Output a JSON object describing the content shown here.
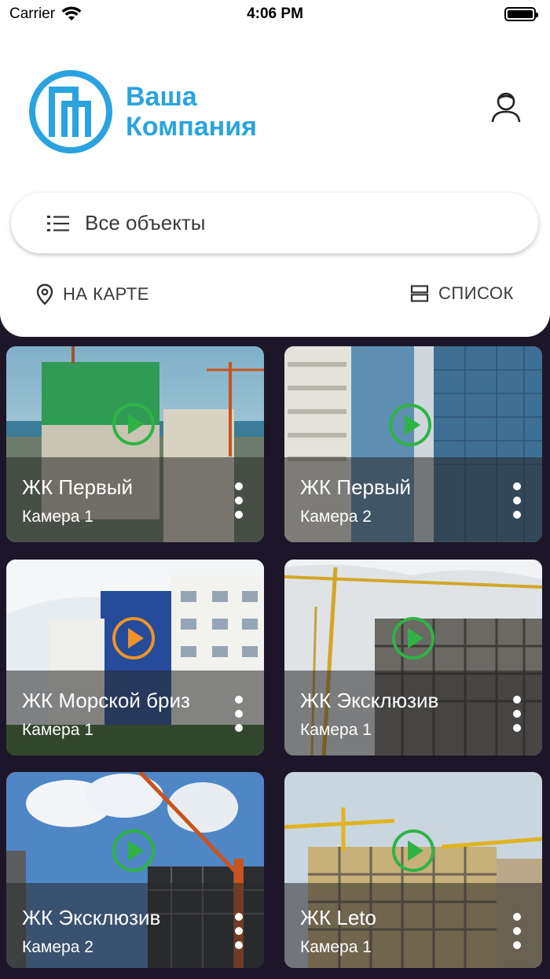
{
  "status_bar": {
    "carrier": "Carrier",
    "time": "4:06 PM"
  },
  "header": {
    "logo_line1": "Ваша",
    "logo_line2": "Компания",
    "brand_color": "#2aa3e0"
  },
  "filter": {
    "label": "Все объекты"
  },
  "view_toggle": {
    "map_label": "НА КАРТЕ",
    "list_label": "СПИСОК"
  },
  "cameras": [
    {
      "title": "ЖК Первый",
      "subtitle": "Камера 1",
      "status_color": "#2fb344"
    },
    {
      "title": "ЖК Первый",
      "subtitle": "Камера 2",
      "status_color": "#2fb344"
    },
    {
      "title": "ЖК Морской бриз",
      "subtitle": "Камера 1",
      "status_color": "#f0922a"
    },
    {
      "title": "ЖК Эксклюзив",
      "subtitle": "Камера 1",
      "status_color": "#2fb344"
    },
    {
      "title": "ЖК Эксклюзив",
      "subtitle": "Камера  2",
      "status_color": "#2fb344"
    },
    {
      "title": "ЖК Leto",
      "subtitle": "Камера 1",
      "status_color": "#2fb344"
    }
  ]
}
